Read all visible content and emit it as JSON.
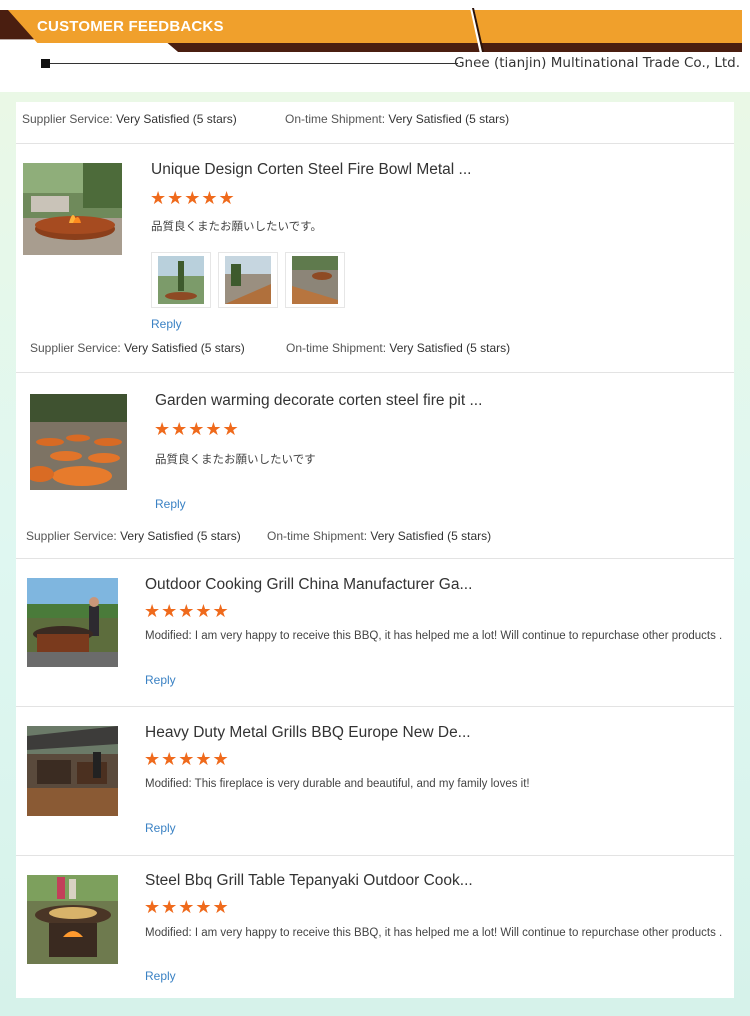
{
  "header": {
    "title": "CUSTOMER FEEDBACKS",
    "company": "Gnee (tianjin) Multinational Trade Co., Ltd."
  },
  "top_summary": {
    "supplier_label": "Supplier Service:",
    "supplier_value": "Very Satisfied",
    "supplier_stars": "(5 stars)",
    "shipment_label": "On-time Shipment:",
    "shipment_value": "Very Satisfied",
    "shipment_stars": "(5 stars)"
  },
  "reviews": [
    {
      "title": "Unique Design Corten Steel Fire Bowl Metal ...",
      "stars": "★★★★★",
      "comment": "品質良くまたお願いしたいです。",
      "reply": "Reply",
      "supplier_label": "Supplier Service:",
      "supplier_value": "Very Satisfied",
      "supplier_stars": "(5 stars)",
      "shipment_label": "On-time Shipment:",
      "shipment_value": "Very Satisfied",
      "shipment_stars": "(5 stars)"
    },
    {
      "title": "Garden warming decorate corten steel fire pit ...",
      "stars": "★★★★★",
      "comment": "品質良くまたお願いしたいです",
      "reply": "Reply",
      "supplier_label": "Supplier Service:",
      "supplier_value": "Very Satisfied",
      "supplier_stars": "(5 stars)",
      "shipment_label": "On-time Shipment:",
      "shipment_value": "Very Satisfied",
      "shipment_stars": "(5 stars)"
    },
    {
      "title": "Outdoor Cooking Grill China Manufacturer Ga...",
      "stars": "★★★★★",
      "modified_label": "Modified:",
      "comment": "I am very happy to receive this BBQ, it has helped me a lot! Will continue to repurchase other products .",
      "reply": "Reply"
    },
    {
      "title": "Heavy Duty Metal Grills BBQ Europe New De...",
      "stars": "★★★★★",
      "modified_label": "Modified:",
      "comment": "This fireplace is very durable and beautiful, and my family loves it!",
      "reply": "Reply"
    },
    {
      "title": "Steel Bbq Grill Table Tepanyaki Outdoor Cook...",
      "stars": "★★★★★",
      "modified_label": "Modified:",
      "comment": "I am very happy to receive this BBQ, it has helped me a lot! Will continue to repurchase other products .",
      "reply": "Reply"
    }
  ],
  "colors": {
    "banner_orange": "#f0a02c",
    "banner_dark": "#4a1e10",
    "star": "#ef6a1c",
    "link": "#3b82c4"
  }
}
